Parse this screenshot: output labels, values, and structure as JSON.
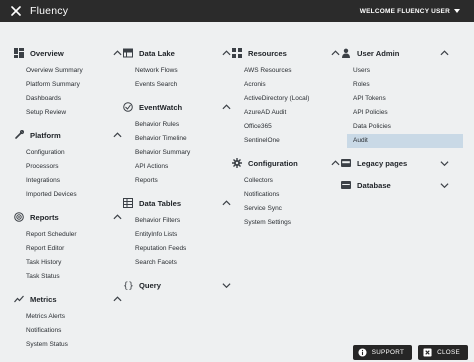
{
  "header": {
    "app_title": "Fluency",
    "welcome_text": "WELCOME FLUENCY USER"
  },
  "columns": [
    {
      "sections": [
        {
          "title": "Overview",
          "icon": "dashboard-icon",
          "expanded": true,
          "items": [
            "Overview Summary",
            "Platform Summary",
            "Dashboards",
            "Setup Review"
          ]
        },
        {
          "title": "Platform",
          "icon": "wrench-icon",
          "expanded": true,
          "items": [
            "Configuration",
            "Processors",
            "Integrations",
            "Imported Devices"
          ]
        },
        {
          "title": "Reports",
          "icon": "target-icon",
          "expanded": true,
          "items": [
            "Report Scheduler",
            "Report Editor",
            "Task History",
            "Task Status"
          ]
        },
        {
          "title": "Metrics",
          "icon": "chart-line-icon",
          "expanded": true,
          "items": [
            "Metrics Alerts",
            "Notifications",
            "System Status"
          ]
        }
      ]
    },
    {
      "sections": [
        {
          "title": "Data Lake",
          "icon": "database-icon",
          "expanded": true,
          "items": [
            "Network Flows",
            "Events Search"
          ]
        },
        {
          "title": "EventWatch",
          "icon": "eye-circle-icon",
          "expanded": true,
          "items": [
            "Behavior Rules",
            "Behavior Timeline",
            "Behavior Summary",
            "API Actions",
            "Reports"
          ]
        },
        {
          "title": "Data Tables",
          "icon": "table-icon",
          "expanded": true,
          "items": [
            "Behavior Filters",
            "EntityInfo Lists",
            "Reputation Feeds",
            "Search Facets"
          ]
        },
        {
          "title": "Query",
          "icon": "braces-icon",
          "expanded": false,
          "items": []
        }
      ]
    },
    {
      "sections": [
        {
          "title": "Resources",
          "icon": "grid-icon",
          "expanded": true,
          "items": [
            "AWS Resources",
            "Acronis",
            "ActiveDirectory (Local)",
            "AzureAD Audit",
            "Office365",
            "SentinelOne"
          ]
        },
        {
          "title": "Configuration",
          "icon": "gear-icon",
          "expanded": true,
          "items": [
            "Collectors",
            "Notifications",
            "Service Sync",
            "System Settings"
          ]
        }
      ]
    },
    {
      "sections": [
        {
          "title": "User Admin",
          "icon": "users-icon",
          "expanded": true,
          "items": [
            "Users",
            "Roles",
            "API Tokens",
            "API Policies",
            "Data Policies",
            "Audit"
          ],
          "active_index": 5
        },
        {
          "title": "Legacy pages",
          "icon": "folder-icon",
          "expanded": false,
          "items": []
        },
        {
          "title": "Database",
          "icon": "server-icon",
          "expanded": false,
          "items": []
        }
      ]
    }
  ],
  "footer": {
    "support_label": "SUPPORT",
    "close_label": "CLOSE"
  },
  "colors": {
    "topbar": "#2b2b2b",
    "background": "#eef0f1",
    "active_item": "#c9d9e6"
  }
}
